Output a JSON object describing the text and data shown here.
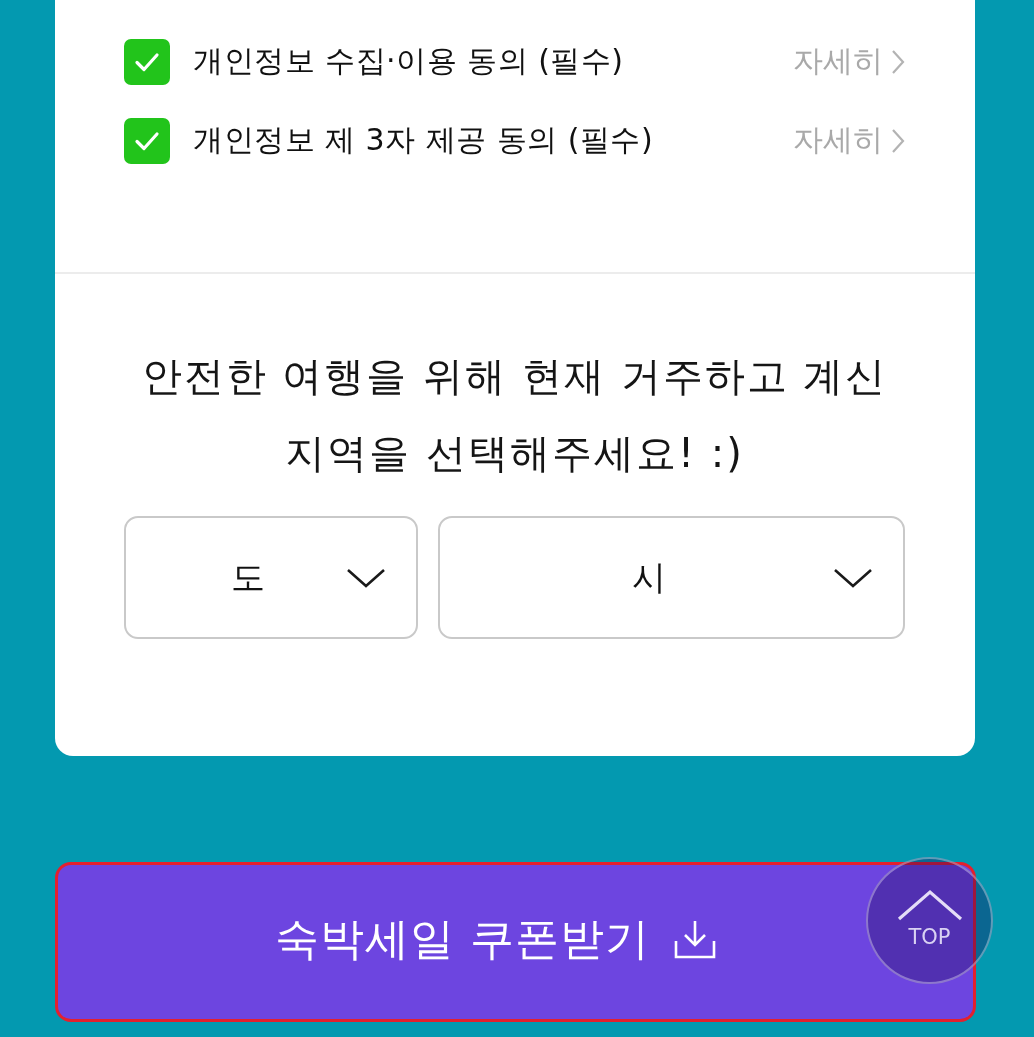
{
  "agreements": [
    {
      "label": "개인정보 수집·이용 동의 (필수)",
      "checked": true,
      "details": "자세히"
    },
    {
      "label": "개인정보 제 3자 제공 동의 (필수)",
      "checked": true,
      "details": "자세히"
    }
  ],
  "region": {
    "notice": "안전한 여행을 위해 현재 거주하고 계신 지역을 선택해주세요! :)",
    "selects": [
      {
        "value": "도"
      },
      {
        "value": "시"
      }
    ]
  },
  "coupon_button": {
    "label": "숙박세일 쿠폰받기"
  },
  "top_button": {
    "label": "TOP"
  }
}
